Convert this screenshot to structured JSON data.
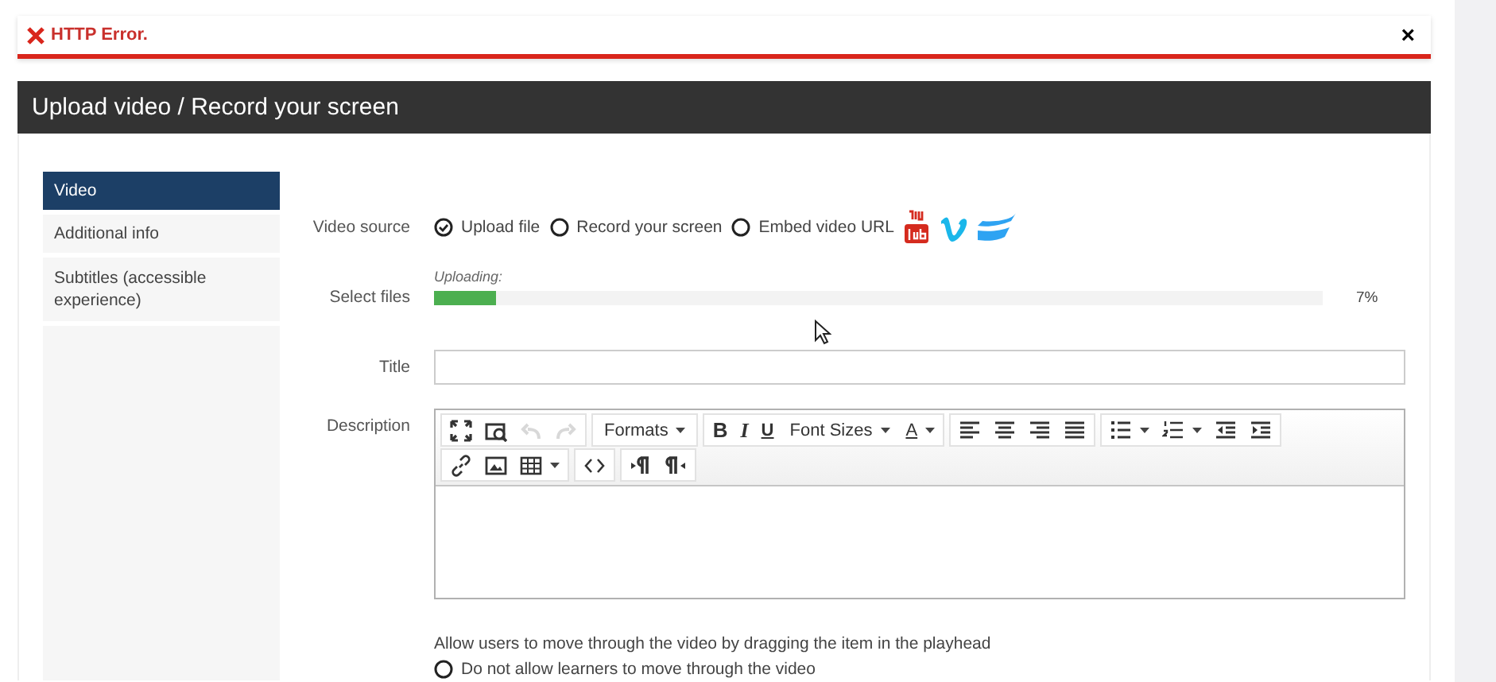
{
  "alert": {
    "message": "HTTP Error.",
    "close": "×"
  },
  "panel": {
    "title": "Upload video / Record your screen"
  },
  "sidebar": {
    "items": [
      {
        "label": "Video",
        "selected": true
      },
      {
        "label": "Additional info",
        "selected": false
      },
      {
        "label": "Subtitles (accessible experience)",
        "selected": false
      }
    ]
  },
  "form": {
    "video_source": {
      "label": "Video source",
      "options": [
        {
          "label": "Upload file",
          "selected": true
        },
        {
          "label": "Record your screen",
          "selected": false
        },
        {
          "label": "Embed video URL",
          "selected": false
        }
      ],
      "services": [
        {
          "kind": "youtube"
        },
        {
          "kind": "vimeo"
        },
        {
          "kind": "wistia"
        }
      ]
    },
    "select_files": {
      "label": "Select files",
      "status": "Uploading:",
      "level": 0.07,
      "reading": "7%"
    },
    "title": {
      "label": "Title"
    },
    "description": {
      "label": "Description",
      "toolbar": [
        [
          [
            {
              "kind": "fullscreen"
            },
            {
              "kind": "preview"
            },
            {
              "kind": "undo",
              "disabled": true
            },
            {
              "kind": "redo",
              "disabled": true
            }
          ],
          [
            {
              "kind": "dropdown",
              "label": "Formats"
            }
          ],
          [
            {
              "kind": "bold",
              "label": "B"
            },
            {
              "kind": "italic",
              "label": "I"
            },
            {
              "kind": "underline",
              "label": "U"
            },
            {
              "kind": "dropdown",
              "label": "Font Sizes"
            },
            {
              "kind": "color",
              "label": "A"
            }
          ],
          [
            {
              "kind": "alignleft"
            },
            {
              "kind": "aligncenter"
            },
            {
              "kind": "alignright"
            },
            {
              "kind": "justify"
            }
          ],
          [
            {
              "kind": "bullist"
            },
            {
              "kind": "numlist"
            },
            {
              "kind": "outdent"
            },
            {
              "kind": "indent"
            }
          ]
        ],
        [
          [
            {
              "kind": "link"
            },
            {
              "kind": "image"
            },
            {
              "kind": "table"
            }
          ],
          [
            {
              "kind": "code"
            }
          ],
          [
            {
              "kind": "ltr"
            },
            {
              "kind": "rtl"
            }
          ]
        ]
      ]
    },
    "playhead": {
      "text": "Allow users to move through the video by dragging the item in the playhead",
      "options": [
        {
          "label": "Do not allow learners to move through the video",
          "selected": false
        }
      ]
    }
  }
}
